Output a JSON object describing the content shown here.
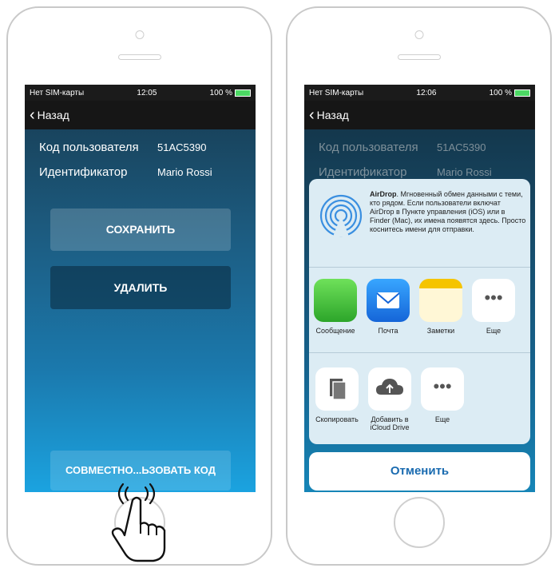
{
  "left_phone": {
    "status": {
      "carrier": "Нет SIM-карты",
      "time": "12:05",
      "battery": "100 %"
    },
    "nav": {
      "back_label": "Назад"
    },
    "rows": [
      {
        "label": "Код пользователя",
        "value": "51AC5390"
      },
      {
        "label": "Идентификатор",
        "value": "Mario Rossi"
      }
    ],
    "buttons": {
      "save": "СОХРАНИТЬ",
      "delete": "УДАЛИТЬ",
      "share": "СОВМЕСТНО...ЬЗОВАТЬ КОД"
    }
  },
  "right_phone": {
    "status": {
      "carrier": "Нет SIM-карты",
      "time": "12:06",
      "battery": "100 %"
    },
    "nav": {
      "back_label": "Назад"
    },
    "rows": [
      {
        "label": "Код пользователя",
        "value": "51AC5390"
      },
      {
        "label": "Идентификатор",
        "value": "Mario Rossi"
      }
    ],
    "airdrop": {
      "title": "AirDrop",
      "text": ". Мгновенный обмен данными с теми, кто рядом. Если пользователи включат AirDrop в Пункте управления (iOS) или в Finder (Mac), их имена появятся здесь. Просто коснитесь имени для отправки."
    },
    "apps": [
      {
        "label": "Сообщение",
        "icon": "messages-icon"
      },
      {
        "label": "Почта",
        "icon": "mail-icon"
      },
      {
        "label": "Заметки",
        "icon": "notes-icon"
      },
      {
        "label": "Еще",
        "icon": "more-icon"
      }
    ],
    "actions": [
      {
        "label": "Скопировать",
        "icon": "copy-icon"
      },
      {
        "label": "Добавить в iCloud Drive",
        "icon": "icloud-upload-icon"
      },
      {
        "label": "Еще",
        "icon": "more-icon"
      }
    ],
    "cancel_label": "Отменить"
  },
  "colors": {
    "accent": "#1a6bb0",
    "screen_top": "#173a4f",
    "screen_bottom": "#1ba3e0"
  }
}
